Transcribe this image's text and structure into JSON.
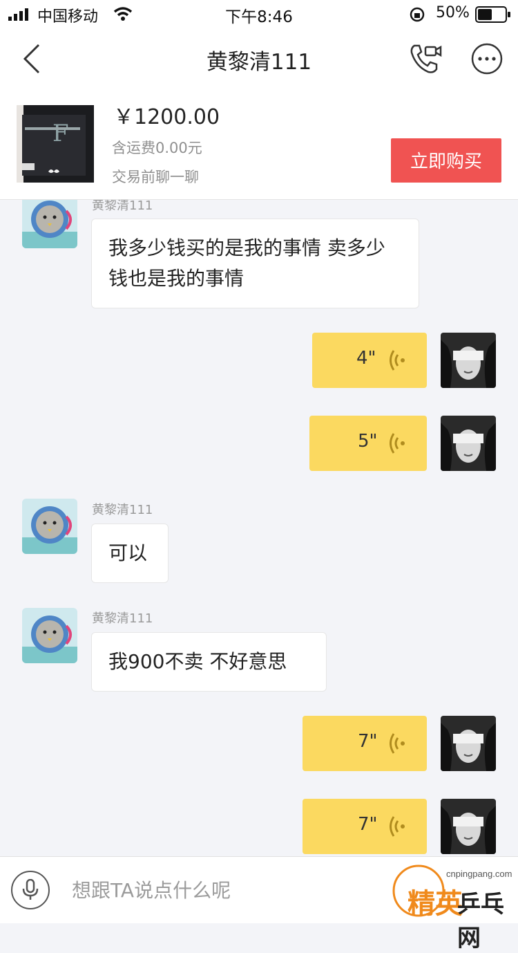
{
  "status_bar": {
    "carrier": "中国移动",
    "time": "下午8:46",
    "battery": "50%"
  },
  "nav": {
    "title": "黄黎清111"
  },
  "product": {
    "price": "￥1200.00",
    "shipping": "含运费0.00元",
    "chat_hint": "交易前聊一聊",
    "buy_label": "立即购买"
  },
  "messages": [
    {
      "side": "left",
      "sender": "黄黎清111",
      "text": "我多少钱买的是我的事情 卖多少钱也是我的事情"
    },
    {
      "side": "right",
      "voice": "4\""
    },
    {
      "side": "right",
      "voice": "5\""
    },
    {
      "side": "left",
      "sender": "黄黎清111",
      "text": "可以"
    },
    {
      "side": "left",
      "sender": "黄黎清111",
      "text": "我900不卖 不好意思"
    },
    {
      "side": "right",
      "voice": "7\""
    },
    {
      "side": "right",
      "voice": "7\""
    }
  ],
  "input": {
    "placeholder": "想跟TA说点什么呢"
  },
  "watermark": {
    "url": "cnpingpang.com",
    "brand": "精英",
    "name": "乒乓网"
  },
  "colors": {
    "buy_button": "#f05352",
    "voice_bubble": "#fbd960",
    "background": "#f3f4f8"
  }
}
